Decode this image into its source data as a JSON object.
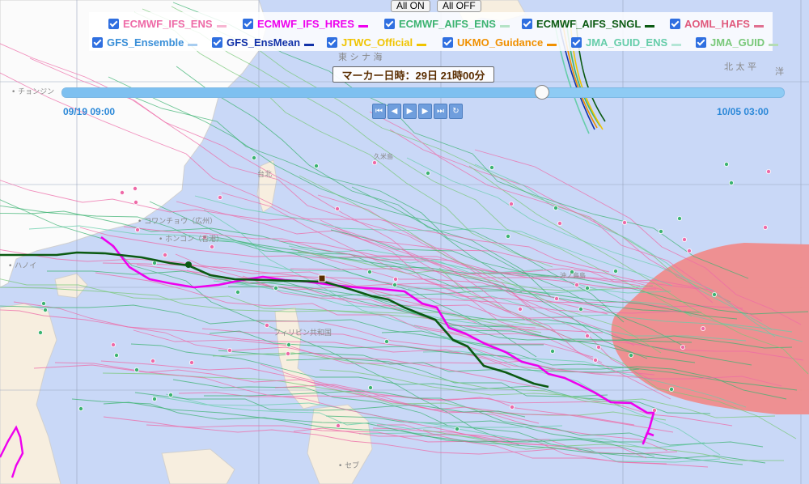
{
  "map": {
    "place_labels": [
      {
        "name": "label-higashi-china-sea",
        "text": "東 シ ナ 海"
      },
      {
        "name": "label-north-pacific-1",
        "text": "北 太 平"
      },
      {
        "name": "label-north-pacific-2",
        "text": "洋"
      },
      {
        "name": "label-chongjin",
        "text": "• チョンジン"
      },
      {
        "name": "label-guangzhou",
        "text": "• コワンチョウ（広州）"
      },
      {
        "name": "label-hongkong",
        "text": "• ホンコン（香港）"
      },
      {
        "name": "label-hanoi",
        "text": "• ハノイ"
      },
      {
        "name": "label-philippines",
        "text": "フィリピン共和国"
      },
      {
        "name": "label-taipei",
        "text": "台北"
      },
      {
        "name": "label-okinotori",
        "text": "沖ノ鳥島"
      },
      {
        "name": "label-kumejima",
        "text": "久米島"
      },
      {
        "name": "label-cebu",
        "text": "• セブ"
      }
    ]
  },
  "top_buttons": {
    "all_on": "All ON",
    "all_off": "All OFF"
  },
  "legend": {
    "row1": [
      {
        "label": "ECMWF_IFS_ENS",
        "color": "#ee6aa7",
        "swatch": "#f7b6d2"
      },
      {
        "label": "ECMWF_IFS_HRES",
        "color": "#ee00ee",
        "swatch": "#ee00ee"
      },
      {
        "label": "ECMWF_AIFS_ENS",
        "color": "#3cb371",
        "swatch": "#b4e3c6"
      },
      {
        "label": "ECMWF_AIFS_SNGL",
        "color": "#0b5a12",
        "swatch": "#0b5a12"
      },
      {
        "label": "AOML_HAFS",
        "color": "#e05a7d",
        "swatch": "#e07090"
      }
    ],
    "row2": [
      {
        "label": "GFS_Ensemble",
        "color": "#3a8fd8",
        "swatch": "#a8cdf0"
      },
      {
        "label": "GFS_EnsMean",
        "color": "#1232a8",
        "swatch": "#1232a8"
      },
      {
        "label": "JTWC_Official",
        "color": "#f0c400",
        "swatch": "#f0c400"
      },
      {
        "label": "UKMO_Guidance",
        "color": "#f09000",
        "swatch": "#f09000"
      },
      {
        "label": "JMA_GUID_ENS",
        "color": "#66cdaa",
        "swatch": "#b4e6d6"
      },
      {
        "label": "JMA_GUID",
        "color": "#78c878",
        "swatch": "#b4dcb4"
      }
    ]
  },
  "marker_label": "マーカー日時：29日 21時00分",
  "slider": {
    "start": "09/19 09:00",
    "end": "10/05 03:00",
    "progress": 0.665
  },
  "controls": [
    {
      "name": "first-frame-button",
      "glyph": "⏮"
    },
    {
      "name": "prev-frame-button",
      "glyph": "◀"
    },
    {
      "name": "play-button",
      "glyph": "▶"
    },
    {
      "name": "next-frame-button",
      "glyph": "▶"
    },
    {
      "name": "last-frame-button",
      "glyph": "⏭"
    },
    {
      "name": "loop-button",
      "glyph": "↻"
    }
  ]
}
